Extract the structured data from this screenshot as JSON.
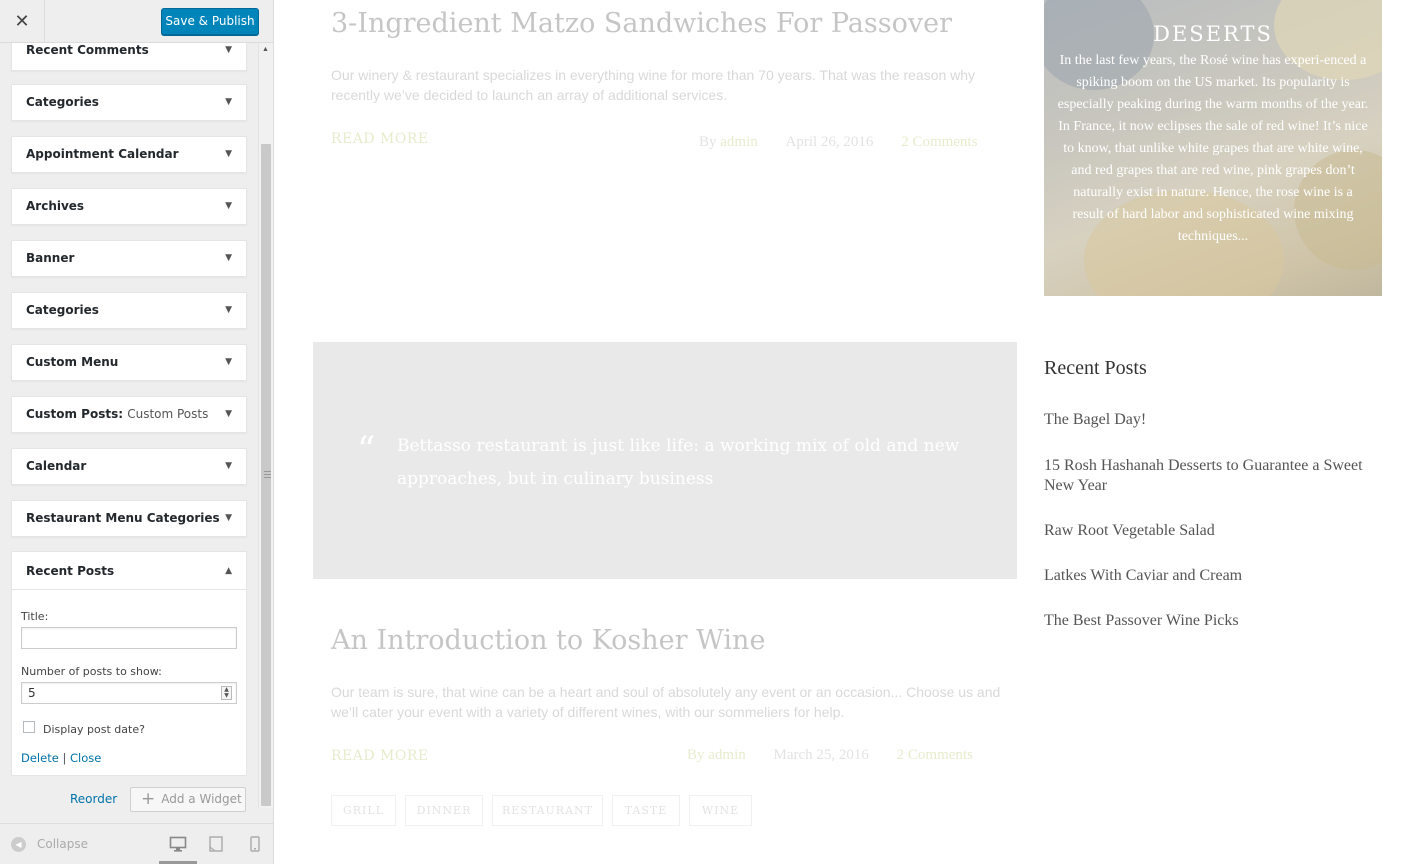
{
  "customizer": {
    "close_symbol": "✕",
    "save_label": "Save & Publish",
    "widgets": [
      {
        "label": "Recent Comments",
        "sub": ""
      },
      {
        "label": "Categories",
        "sub": ""
      },
      {
        "label": "Appointment Calendar",
        "sub": ""
      },
      {
        "label": "Archives",
        "sub": ""
      },
      {
        "label": "Banner",
        "sub": ""
      },
      {
        "label": "Categories",
        "sub": ""
      },
      {
        "label": "Custom Menu",
        "sub": ""
      },
      {
        "label": "Custom Posts:",
        "sub": "Custom Posts"
      },
      {
        "label": "Calendar",
        "sub": ""
      },
      {
        "label": "Restaurant Menu Categories",
        "sub": ""
      }
    ],
    "expanded_widget": {
      "label": "Recent Posts",
      "title_label": "Title:",
      "title_value": "",
      "number_label": "Number of posts to show:",
      "number_value": "5",
      "display_date_label": "Display post date?",
      "display_date_checked": false,
      "delete_label": "Delete",
      "separator": "|",
      "close_label": "Close"
    },
    "reorder_label": "Reorder",
    "add_widget_label": "Add a Widget",
    "collapse_label": "Collapse",
    "icons": [
      "close-icon",
      "chevron-down-icon",
      "chevron-up-icon",
      "plus-icon",
      "collapse-icon",
      "desktop-icon",
      "tablet-icon",
      "mobile-icon"
    ],
    "accent_color": "#0085ba"
  },
  "preview": {
    "post1": {
      "title": "3-Ingredient Matzo Sandwiches For Passover",
      "excerpt": "Our winery & restaurant specializes in everything wine for more than 70 years. That was the reason why recently we’ve decided to launch an array of additional services.",
      "read_more": "READ MORE",
      "by": "By",
      "author": "admin",
      "date": "April 26, 2016",
      "comments": "2 Comments"
    },
    "quote": {
      "mark": "“",
      "text": "Bettasso restaurant is just like life: a working mix of old and new approaches, but in culinary business"
    },
    "post2": {
      "title": "An Introduction to Kosher Wine",
      "excerpt": "Our team is sure, that wine can be a heart and soul of absolutely any event or an occasion... Choose us and we’ll cater your event with a variety of different wines, with our sommeliers for help.",
      "read_more": "READ MORE",
      "by": "By admin",
      "date": "March 25, 2016",
      "comments": "2 Comments",
      "tags": [
        "GRILL",
        "DINNER",
        "RESTAURANT",
        "TASTE",
        "WINE"
      ]
    },
    "deserts": {
      "title": "DESERTS",
      "text": "In the last few years, the Rosé wine has experi-enced a spiking boom on the US market. Its popularity is especially peaking during the warm months of the year. In France, it now eclipses the sale of red wine! It’s nice to know, that unlike white grapes that are white wine, and red grapes that are red wine, pink grapes don’t naturally exist in nature. Hence, the rose wine is a result of hard labor and sophisticated wine mixing techniques..."
    },
    "recent_posts": {
      "heading": "Recent Posts",
      "items": [
        "The Bagel Day!",
        "15 Rosh Hashanah Desserts to Guarantee a Sweet New Year",
        "Raw Root Vegetable Salad",
        "Latkes With Caviar and Cream",
        "The Best Passover Wine Picks"
      ]
    },
    "accent_color": "#a8b84a"
  }
}
